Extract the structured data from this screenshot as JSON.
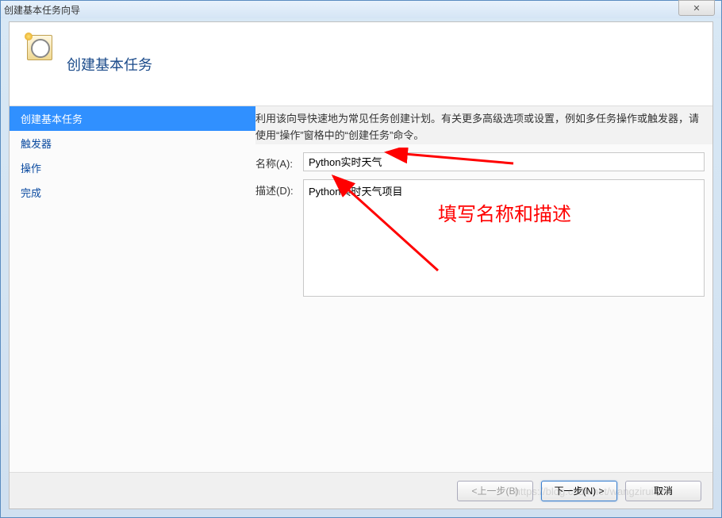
{
  "window": {
    "title": "创建基本任务向导",
    "close_glyph": "✕"
  },
  "header": {
    "title": "创建基本任务"
  },
  "sidebar": {
    "items": [
      {
        "label": "创建基本任务",
        "active": true
      },
      {
        "label": "触发器",
        "active": false
      },
      {
        "label": "操作",
        "active": false
      },
      {
        "label": "完成",
        "active": false
      }
    ]
  },
  "main": {
    "instruction": "利用该向导快速地为常见任务创建计划。有关更多高级选项或设置，例如多任务操作或触发器，请使用“操作”窗格中的“创建任务”命令。",
    "name_label": "名称(A):",
    "name_value": "Python实时天气",
    "desc_label": "描述(D):",
    "desc_value": "Python实时天气项目"
  },
  "annotation": {
    "text": "填写名称和描述",
    "color": "#ff0000"
  },
  "footer": {
    "back": "<上一步(B)",
    "next": "下一步(N) >",
    "cancel": "取消"
  },
  "watermark": "https://blog.csdn.net/wangzirui32"
}
